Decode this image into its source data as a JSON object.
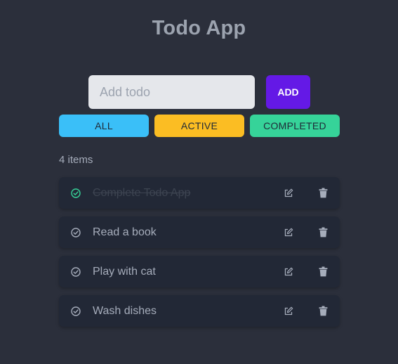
{
  "app": {
    "title": "Todo App"
  },
  "input": {
    "placeholder": "Add todo",
    "value": ""
  },
  "add_button": {
    "label": "ADD"
  },
  "filters": [
    {
      "label": "ALL",
      "color": "#3abff8"
    },
    {
      "label": "ACTIVE",
      "color": "#fbbd23"
    },
    {
      "label": "COMPLETED",
      "color": "#36d399"
    }
  ],
  "count_text": "4 items",
  "todos": [
    {
      "text": "Complete Todo App",
      "completed": true,
      "icon": "check-circle-icon"
    },
    {
      "text": "Read a book",
      "completed": false,
      "icon": "check-circle-icon"
    },
    {
      "text": "Play with cat",
      "completed": false,
      "icon": "check-circle-icon"
    },
    {
      "text": "Wash dishes",
      "completed": false,
      "icon": "check-circle-icon"
    }
  ],
  "colors": {
    "background": "#2b2f3b",
    "card": "#222836",
    "accent": "#6419e6",
    "done_check": "#36d399"
  }
}
